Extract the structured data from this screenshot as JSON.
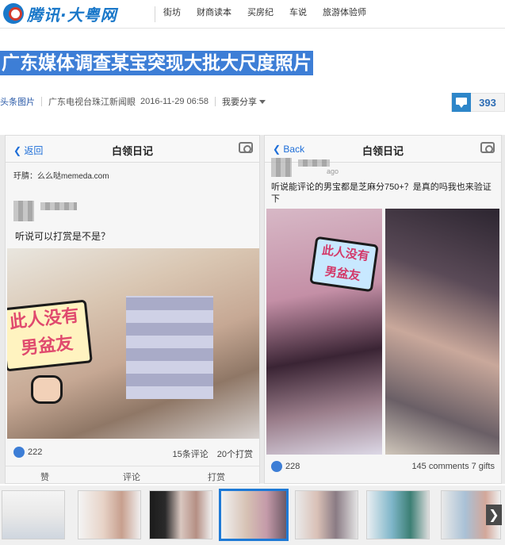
{
  "header": {
    "logo_text": "腾讯·大粤网",
    "nav": [
      "街坊",
      "财商读本",
      "买房纪",
      "车说",
      "旅游体验师"
    ]
  },
  "article": {
    "title": "广东媒体调查某宝突现大批大尺度照片",
    "category": "头条图片",
    "source": "广东电视台珠江新闻眼",
    "datetime": "2016-11-29 06:58",
    "share_label": "我要分享",
    "comment_count": "393"
  },
  "left_post": {
    "back": "返回",
    "header_title": "白领日记",
    "ad_line": "玗腈：么么哒memeda.com",
    "text": "听说可以打赏是不是？",
    "sticker_text": "此人没有男盆友",
    "likes": "222",
    "stats": "15条评论　20个打赏",
    "actions": [
      "赞",
      "评论",
      "打赏"
    ]
  },
  "right_post": {
    "back": "Back",
    "header_title": "白领日记",
    "time": "ago",
    "text": "听说能评论的男宝都是芝麻分750+？是真的吗我也来验证下",
    "sticker_text": "此人没有男盆友",
    "likes": "228",
    "stats": "145 comments 7 gifts"
  },
  "strip": {
    "prev": "❮",
    "next": "❯",
    "active_index": 3
  }
}
